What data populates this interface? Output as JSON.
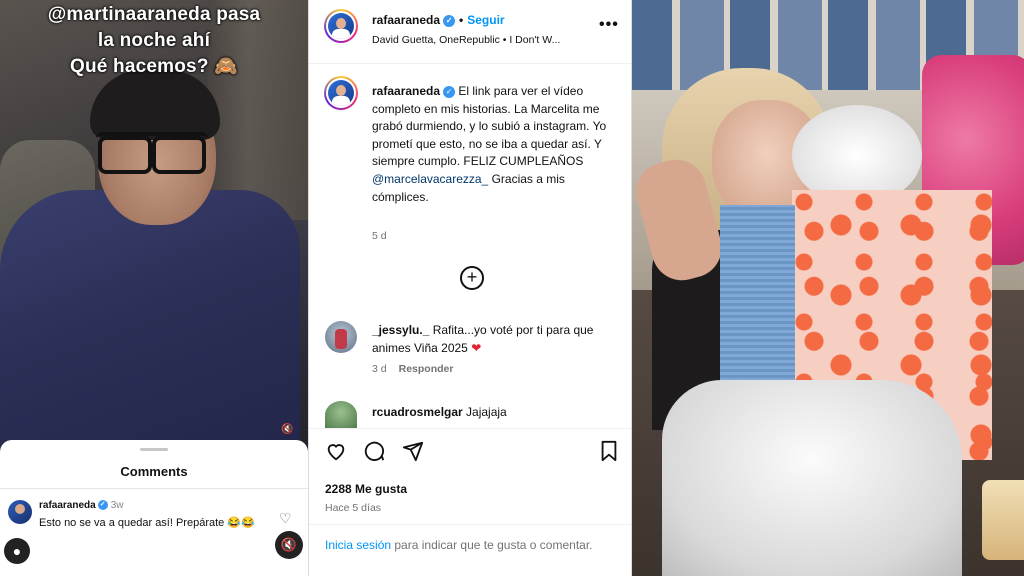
{
  "story": {
    "line1": "@martinaaraneda pasa",
    "line2": "la noche ahí",
    "line3": "Qué hacemos? 🙈",
    "sheet_title": "Comments",
    "comment": {
      "user": "rafaaraneda",
      "time": "3w",
      "text": "Esto no se va a quedar así! Prepárate 😂😂"
    }
  },
  "post": {
    "header": {
      "user": "rafaaraneda",
      "follow": "Seguir",
      "music": "David Guetta, OneRepublic • I Don't W..."
    },
    "caption": {
      "user": "rafaaraneda",
      "text_a": "El link para ver el vídeo completo en mis historias. La Marcelita me grabó durmiendo, y lo subió a instagram. Yo prometí que esto, no se iba a quedar así. Y siempre cumplo. FELIZ CUMPLEAÑOS ",
      "mention": "@marcelavacarezza_",
      "text_b": " Gracias a mis cómplices.",
      "time": "5 d"
    },
    "comments": [
      {
        "user": "_jessylu._",
        "text": " Rafita...yo voté por ti para que animes Viña 2025 ",
        "time": "3 d",
        "reply": "Responder"
      },
      {
        "user": "rcuadrosmelgar",
        "text": " Jajajaja"
      }
    ],
    "likes": "2288 Me gusta",
    "ago": "Hace 5 días",
    "login_link": "Inicia sesión",
    "login_text": " para indicar que te gusta o comentar."
  },
  "icons": [
    "verified-badge-icon",
    "more-options-icon",
    "add-icon",
    "heart-icon",
    "comment-icon",
    "share-icon",
    "bookmark-icon",
    "mute-icon",
    "profile-icon"
  ],
  "colors": {
    "link": "#0095f6",
    "verified": "#3897f0",
    "heart": "#e02436"
  }
}
